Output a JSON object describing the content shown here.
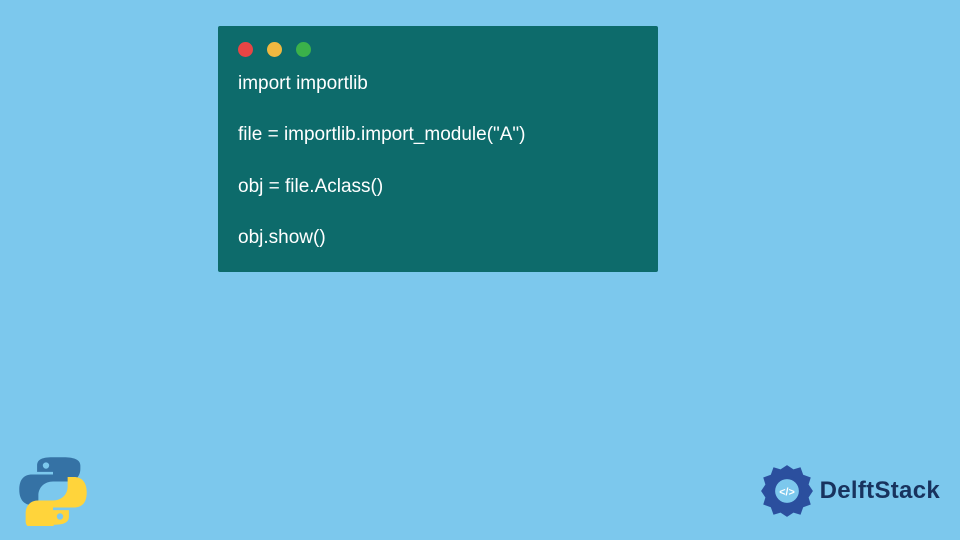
{
  "code": {
    "lines": [
      "import importlib",
      "",
      "file = importlib.import_module(\"A\")",
      "",
      "obj = file.Aclass()",
      "",
      "obj.show()"
    ]
  },
  "brand": {
    "name": "DelftStack"
  }
}
